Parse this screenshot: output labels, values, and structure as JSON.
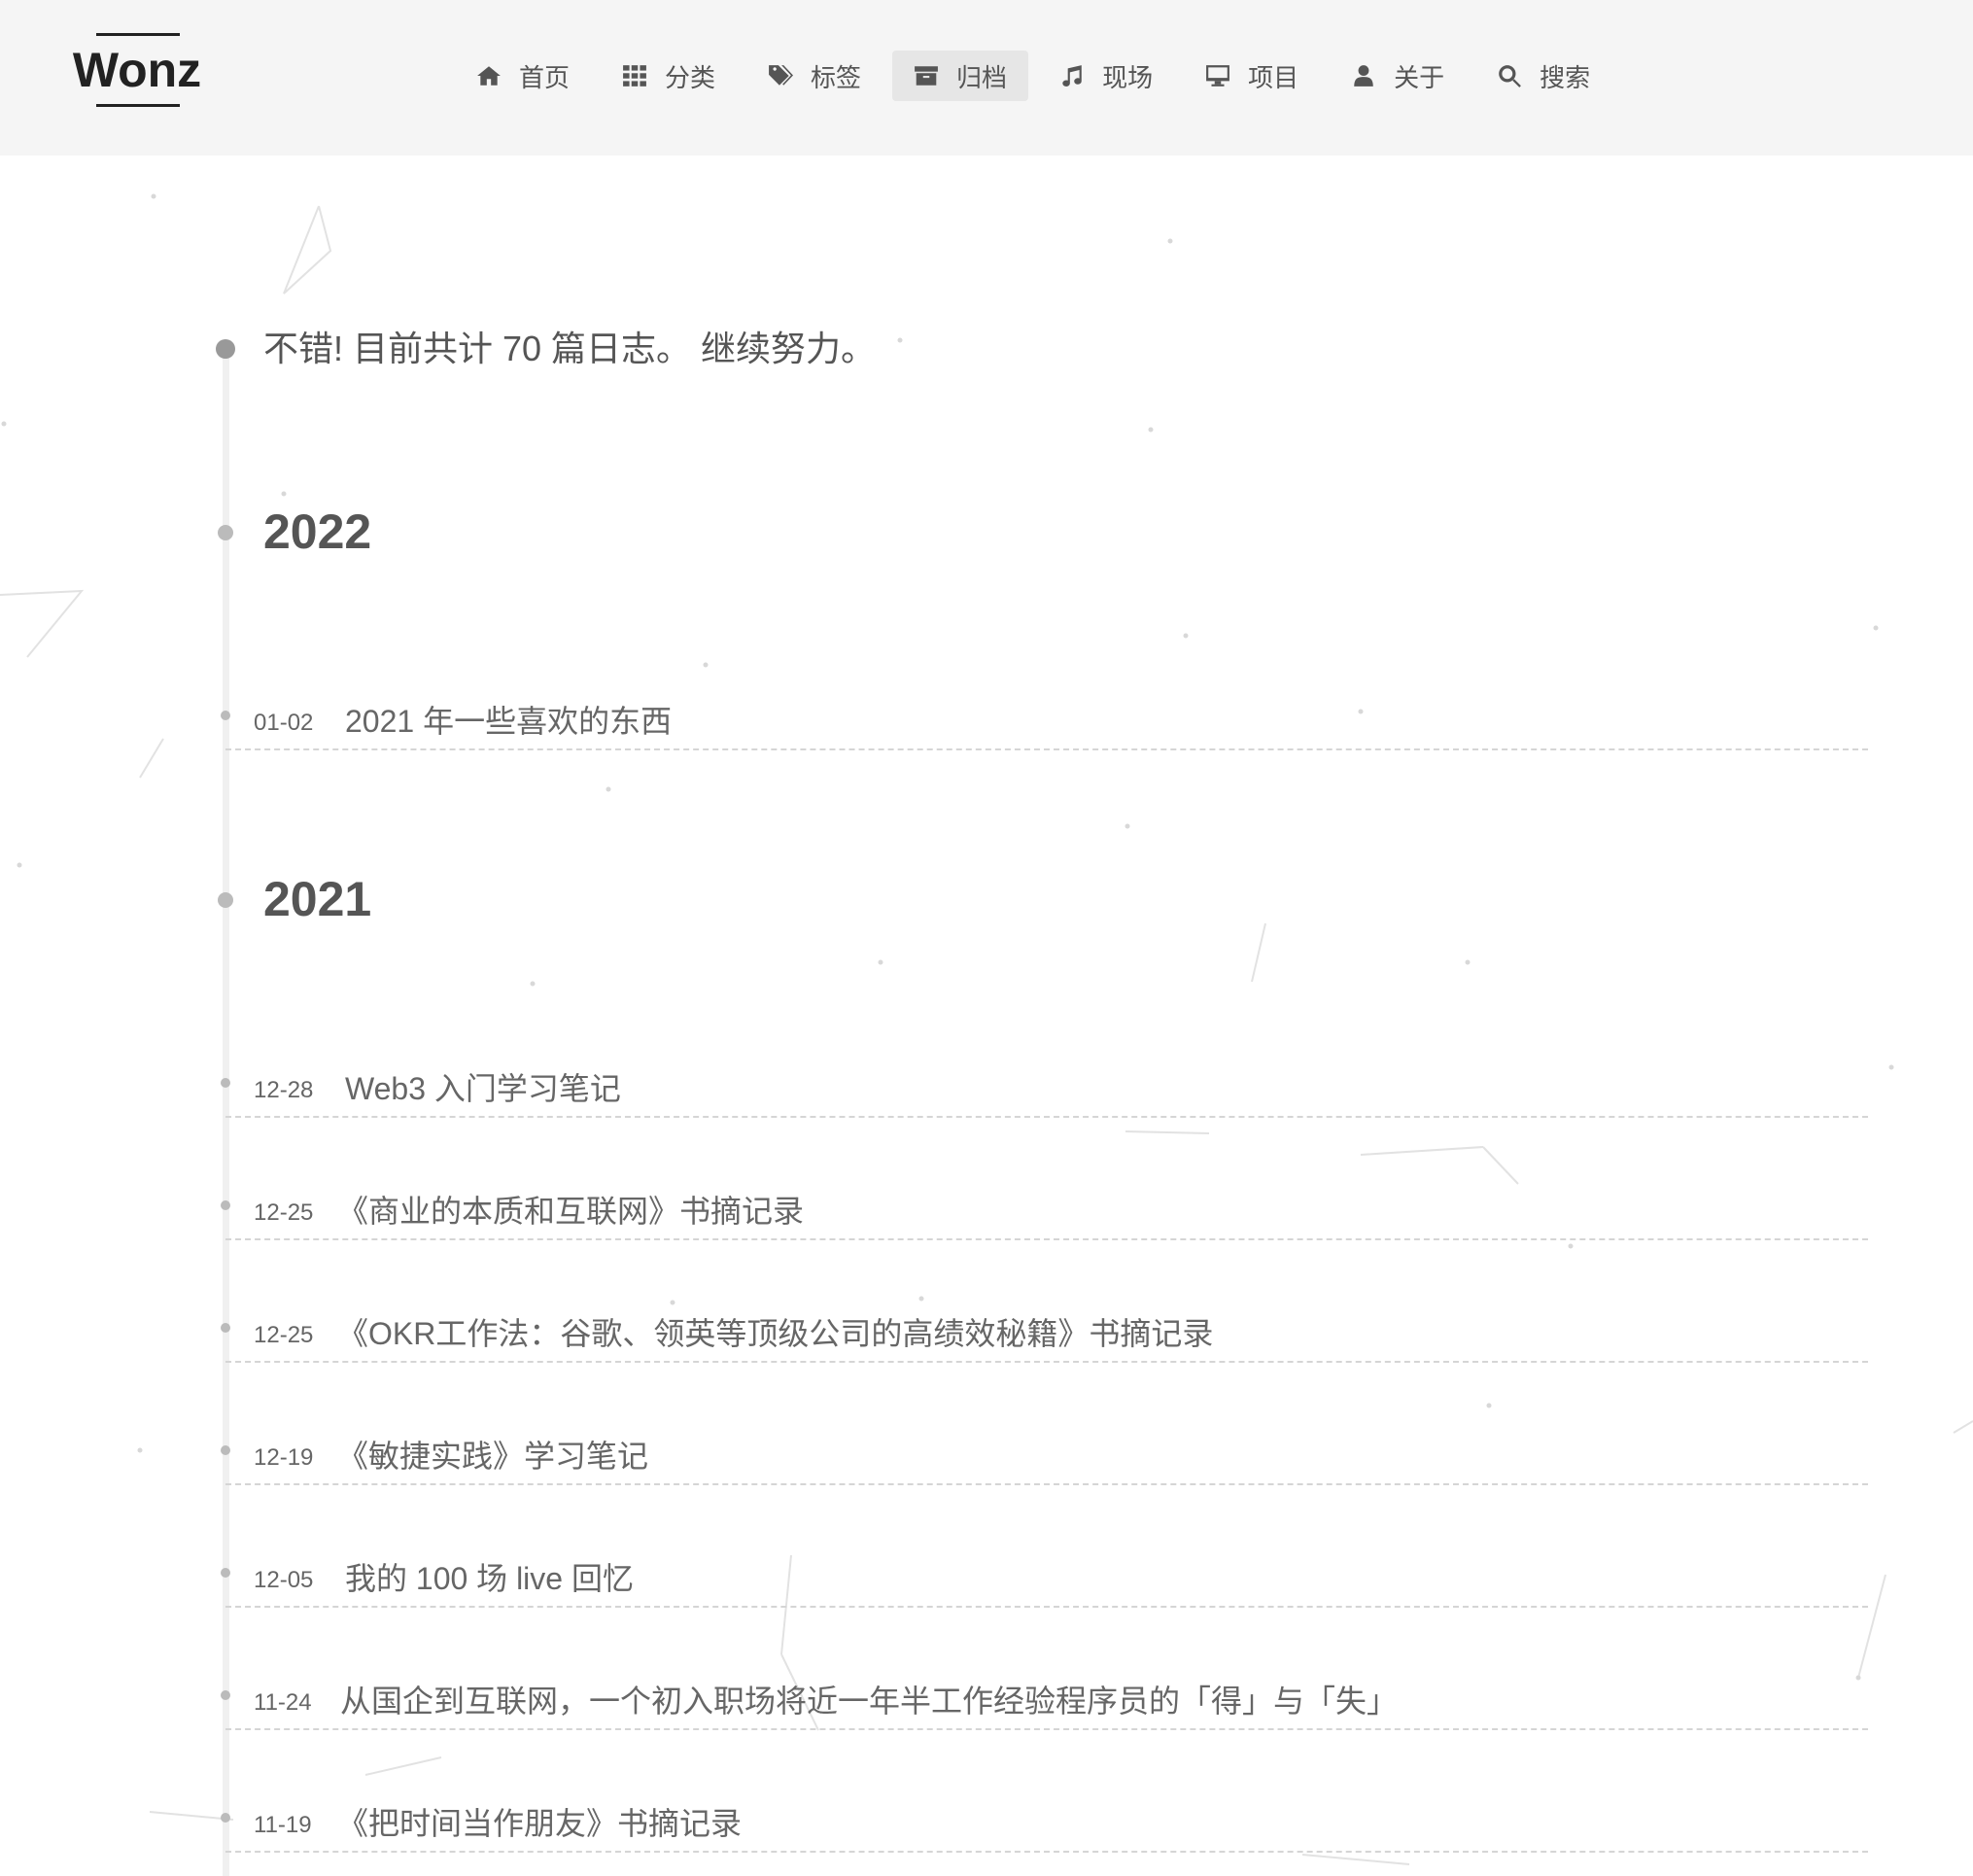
{
  "header": {
    "logo": "Wonz",
    "nav": [
      {
        "label": "首页",
        "icon": "home-icon",
        "active": false
      },
      {
        "label": "分类",
        "icon": "grid-icon",
        "active": false
      },
      {
        "label": "标签",
        "icon": "tags-icon",
        "active": false
      },
      {
        "label": "归档",
        "icon": "archive-icon",
        "active": true
      },
      {
        "label": "现场",
        "icon": "music-icon",
        "active": false
      },
      {
        "label": "项目",
        "icon": "desktop-icon",
        "active": false
      },
      {
        "label": "关于",
        "icon": "user-icon",
        "active": false
      },
      {
        "label": "搜索",
        "icon": "search-icon",
        "active": false
      }
    ]
  },
  "archive": {
    "total_text": "不错! 目前共计 70 篇日志。 继续努力。",
    "years": [
      {
        "year": "2022",
        "posts": [
          {
            "date": "01-02",
            "title": "2021 年一些喜欢的东西"
          }
        ]
      },
      {
        "year": "2021",
        "posts": [
          {
            "date": "12-28",
            "title": "Web3 入门学习笔记"
          },
          {
            "date": "12-25",
            "title": "《商业的本质和互联网》书摘记录"
          },
          {
            "date": "12-25",
            "title": "《OKR工作法：谷歌、领英等顶级公司的高绩效秘籍》书摘记录"
          },
          {
            "date": "12-19",
            "title": "《敏捷实践》学习笔记"
          },
          {
            "date": "12-05",
            "title": "我的 100 场 live 回忆"
          },
          {
            "date": "11-24",
            "title": "从国企到互联网，一个初入职场将近一年半工作经验程序员的「得」与「失」"
          },
          {
            "date": "11-19",
            "title": "《把时间当作朋友》书摘记录"
          }
        ]
      }
    ]
  }
}
